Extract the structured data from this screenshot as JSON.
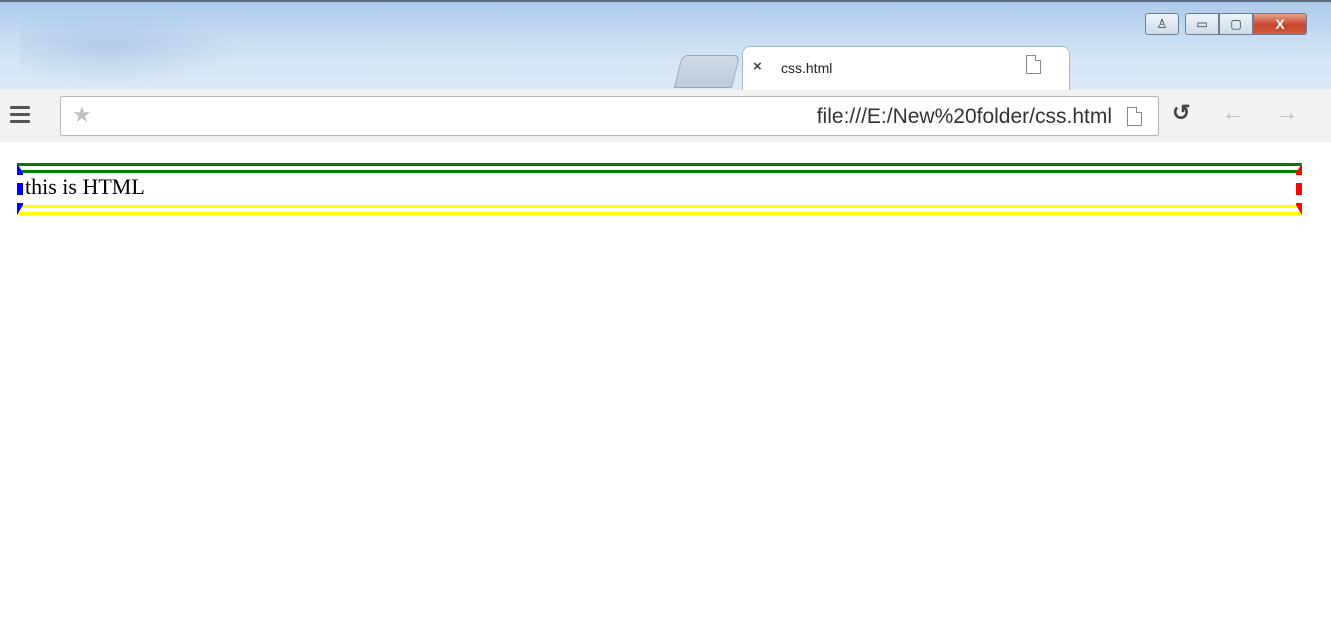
{
  "tab": {
    "title": "css.html",
    "close_glyph": "×"
  },
  "window_controls": {
    "user": "♙",
    "minimize": "▭",
    "maximize": "▢",
    "close": "X"
  },
  "address_bar": {
    "url": "file:///E:/New%20folder/css.html"
  },
  "page": {
    "text": "this is HTML"
  },
  "colors": {
    "border_top": "#008000",
    "border_bottom": "#ffff00",
    "border_left": "#0000cc",
    "border_right": "#cc0000"
  }
}
